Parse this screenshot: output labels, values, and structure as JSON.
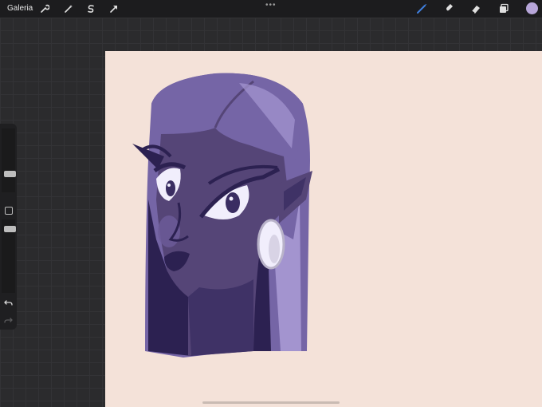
{
  "topbar": {
    "gallery_label": "Galeria",
    "left_tools": [
      "wrench-icon",
      "magic-wand-icon",
      "selection-s-icon",
      "transform-arrow-icon"
    ],
    "more_dots": "•••",
    "right_tools": [
      "brush-icon",
      "smudge-icon",
      "eraser-icon",
      "layers-icon"
    ],
    "active_tool": "brush",
    "active_tool_color": "#3f7fdd",
    "current_color": "#b7a6d9"
  },
  "sidebar": {
    "brush_size_slider": 0.4,
    "opacity_slider": 0.5,
    "modifier": "square-modifier-icon",
    "undo": "undo-arrow-icon",
    "redo": "redo-arrow-icon"
  },
  "canvas": {
    "background_color": "#f4e2d9",
    "artwork": "purple-haired-character-portrait",
    "palette": [
      "#7565a6",
      "#554577",
      "#2c2151",
      "#a394cf",
      "#f1eefc"
    ]
  }
}
